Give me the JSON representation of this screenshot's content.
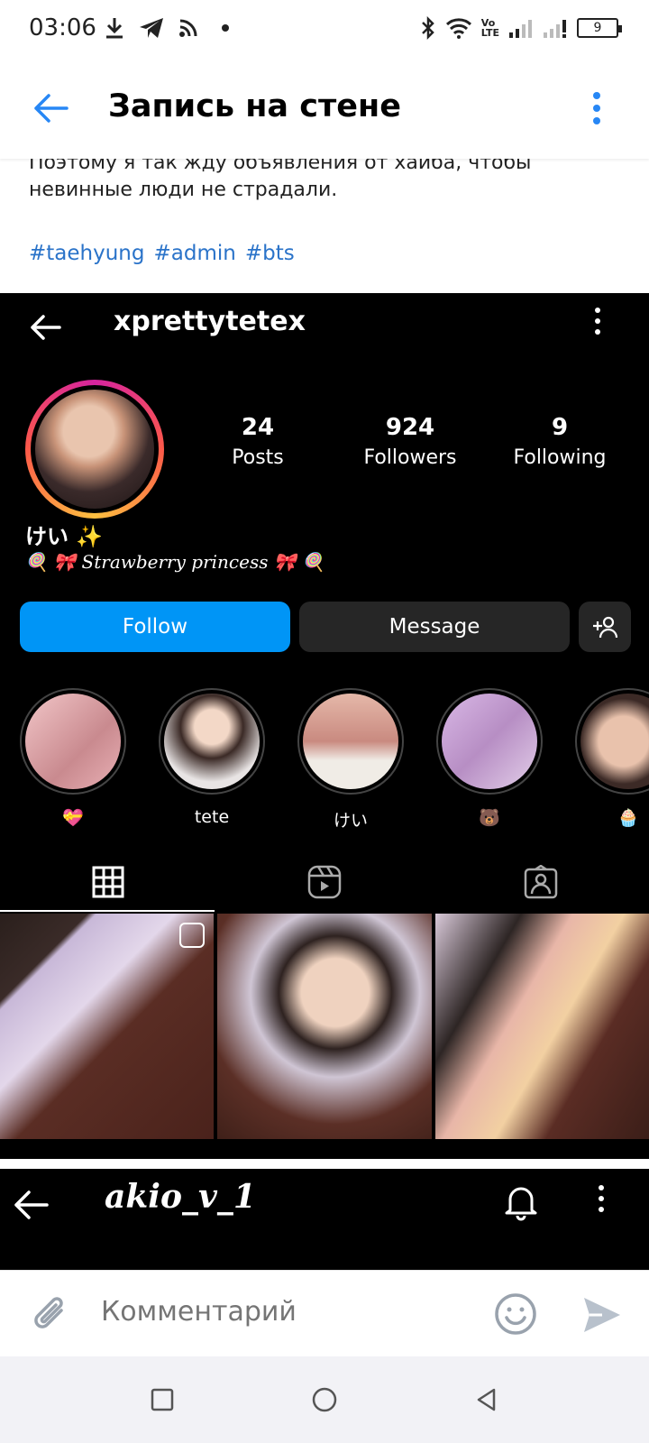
{
  "status_bar": {
    "time": "03:06",
    "volte_top": "Vo",
    "volte_bottom": "LTE",
    "battery": "9"
  },
  "header": {
    "title": "Запись на стене"
  },
  "post": {
    "text_line1": "Поэтому я так жду объявления от хайба, чтобы",
    "text_line2": "невинные люди не страдали.",
    "hashtags": [
      "#taehyung",
      "#admin",
      "#bts"
    ]
  },
  "instagram": {
    "username": "xprettytetex",
    "stats": [
      {
        "value": "24",
        "label": "Posts"
      },
      {
        "value": "924",
        "label": "Followers"
      },
      {
        "value": "9",
        "label": "Following"
      }
    ],
    "name": "けい ✨",
    "bio": "🍭 🎀 Strawberry princess 🎀 🍭",
    "follow_label": "Follow",
    "message_label": "Message",
    "highlights": [
      {
        "label": "💝"
      },
      {
        "label": "tete"
      },
      {
        "label": "けい"
      },
      {
        "label": "🐻"
      },
      {
        "label": "🧁"
      }
    ]
  },
  "second_embed": {
    "title": "akio_v_1"
  },
  "comment": {
    "placeholder": "Комментарий"
  },
  "colors": {
    "vk_blue": "#2787f5",
    "hashtag": "#2a73c9",
    "ig_follow": "#0095f6"
  }
}
